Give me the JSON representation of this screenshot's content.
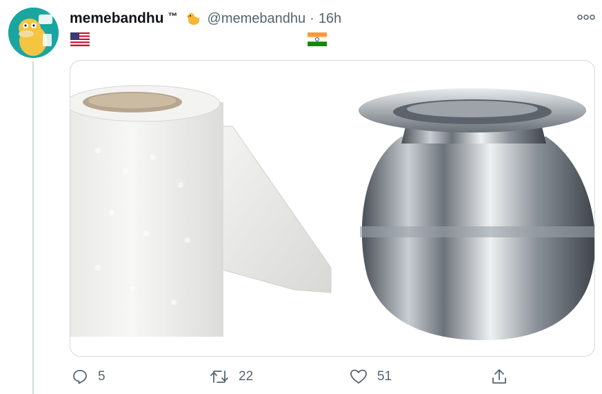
{
  "tweet": {
    "display_name": "memebandhu",
    "trademark": "™",
    "handle": "@memebandhu",
    "separator": "·",
    "time": "16h",
    "flags": {
      "left": "us-flag-icon",
      "right": "india-flag-icon"
    }
  },
  "media": {
    "left_image": "toilet-paper-roll",
    "right_image": "steel-lota-pot"
  },
  "actions": {
    "reply_count": "5",
    "retweet_count": "22",
    "like_count": "51"
  },
  "colors": {
    "text_primary": "#0f1419",
    "text_secondary": "#536471",
    "border": "#cfd9de",
    "avatar_bg": "#1aa5a0"
  }
}
